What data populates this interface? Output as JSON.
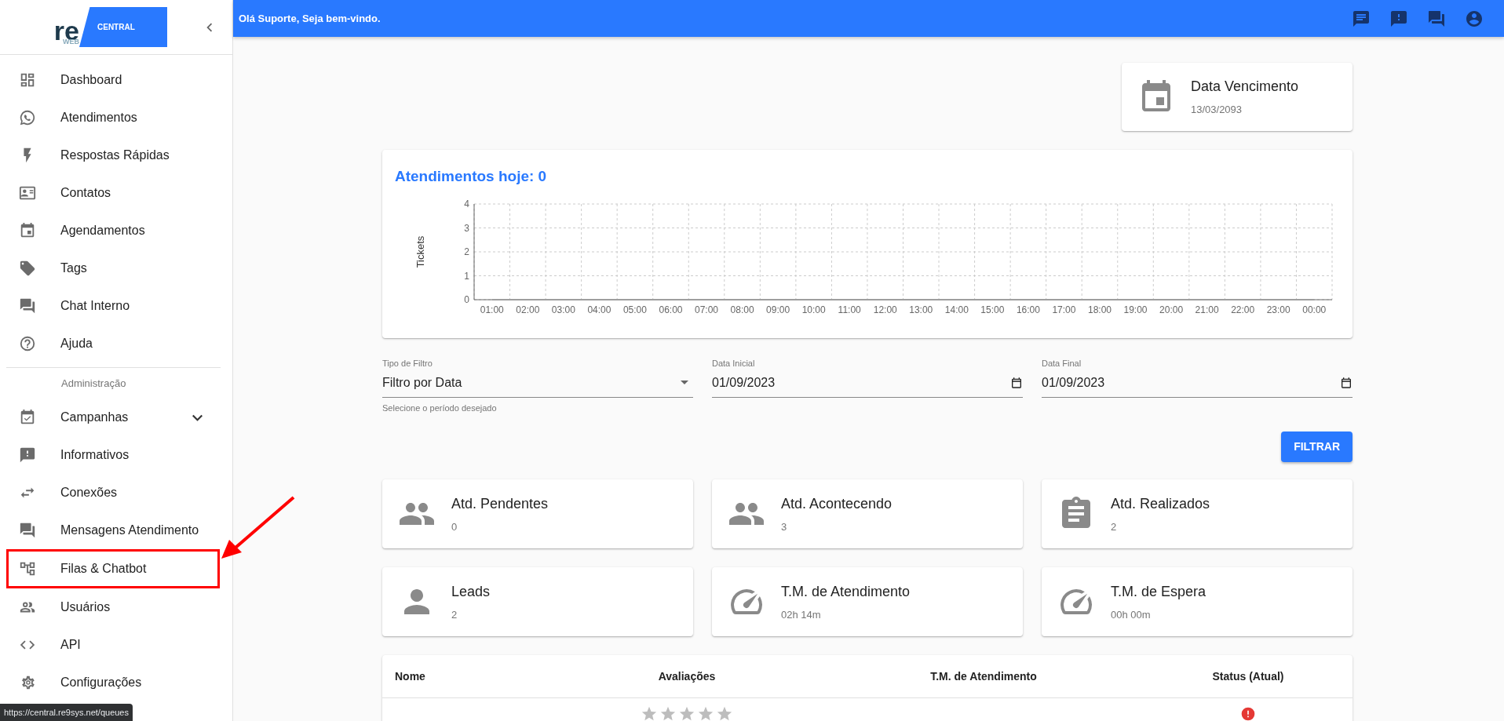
{
  "sidebar": {
    "logo_text": "re",
    "logo_sub": "WEB",
    "logo_badge": "CENTRAL",
    "items": [
      {
        "kind": "item",
        "label": "Dashboard"
      },
      {
        "kind": "item",
        "label": "Atendimentos"
      },
      {
        "kind": "item",
        "label": "Respostas Rápidas"
      },
      {
        "kind": "item",
        "label": "Contatos"
      },
      {
        "kind": "item",
        "label": "Agendamentos"
      },
      {
        "kind": "item",
        "label": "Tags"
      },
      {
        "kind": "item",
        "label": "Chat Interno"
      },
      {
        "kind": "item",
        "label": "Ajuda"
      },
      {
        "kind": "section",
        "label": "Administração"
      },
      {
        "kind": "expandable",
        "label": "Campanhas",
        "expanded": false
      },
      {
        "kind": "item",
        "label": "Informativos"
      },
      {
        "kind": "item",
        "label": "Conexões"
      },
      {
        "kind": "item",
        "label": "Mensagens Atendimento"
      },
      {
        "kind": "item",
        "label": "Filas & Chatbot"
      },
      {
        "kind": "item",
        "label": "Usuários"
      },
      {
        "kind": "item",
        "label": "API"
      },
      {
        "kind": "item",
        "label": "Configurações"
      }
    ]
  },
  "topbar": {
    "greeting": "Olá Suporte, Seja bem-vindo."
  },
  "due_card": {
    "title": "Data Vencimento",
    "value": "13/03/2093"
  },
  "chart_card": {
    "title": "Atendimentos hoje: 0",
    "chart_data": {
      "type": "line",
      "ylabel": "Tickets",
      "categories": [
        "01:00",
        "02:00",
        "03:00",
        "04:00",
        "05:00",
        "06:00",
        "07:00",
        "08:00",
        "09:00",
        "10:00",
        "11:00",
        "12:00",
        "13:00",
        "14:00",
        "15:00",
        "16:00",
        "17:00",
        "18:00",
        "19:00",
        "20:00",
        "21:00",
        "22:00",
        "23:00",
        "00:00"
      ],
      "ylim": [
        0,
        4
      ],
      "yticks": [
        0,
        1,
        2,
        3,
        4
      ],
      "grid": true,
      "series": [
        {
          "color": "#9e9e9e",
          "values": [
            0,
            0,
            0,
            0,
            0,
            0,
            0,
            0,
            0,
            0,
            0,
            0,
            0,
            0,
            0,
            0,
            0,
            0,
            0,
            0,
            0,
            0,
            0,
            0
          ]
        }
      ]
    }
  },
  "filters": {
    "type": {
      "label": "Tipo de Filtro",
      "value": "Filtro por Data",
      "helper": "Selecione o período desejado"
    },
    "start": {
      "label": "Data Inicial",
      "value": "01/09/2023"
    },
    "end": {
      "label": "Data Final",
      "value": "01/09/2023"
    },
    "button": "FILTRAR"
  },
  "stats": [
    {
      "title": "Atd. Pendentes",
      "value": "0"
    },
    {
      "title": "Atd. Acontecendo",
      "value": "3"
    },
    {
      "title": "Atd. Realizados",
      "value": "2"
    },
    {
      "title": "Leads",
      "value": "2"
    },
    {
      "title": "T.M. de Atendimento",
      "value": "02h 14m"
    },
    {
      "title": "T.M. de Espera",
      "value": "00h 00m"
    }
  ],
  "table": {
    "columns": [
      "Nome",
      "Avaliações",
      "T.M. de Atendimento",
      "Status (Atual)"
    ],
    "rows": [
      {
        "stars": 0
      }
    ]
  },
  "status_url": "https://central.re9sys.net/queues"
}
